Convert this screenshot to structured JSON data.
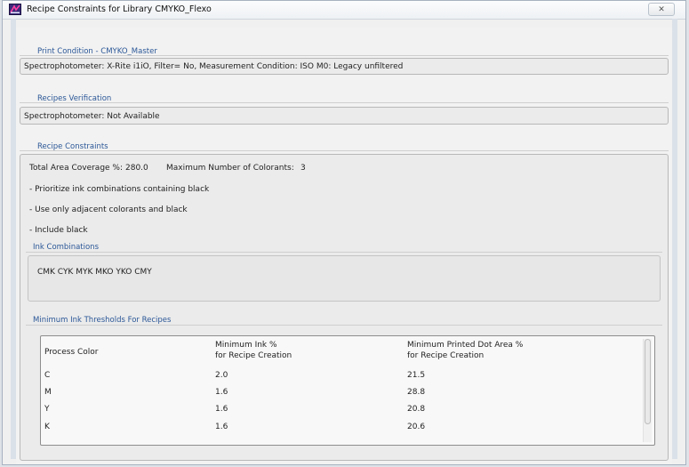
{
  "window": {
    "title": "Recipe Constraints for Library CMYKO_Flexo",
    "close_symbol": "✕"
  },
  "print_condition": {
    "label": "Print Condition - CMYKO_Master",
    "text": "Spectrophotometer: X-Rite i1iO,   Filter= No,   Measurement Condition: ISO M0: Legacy unfiltered"
  },
  "recipes_verification": {
    "label": "Recipes Verification",
    "text": "Spectrophotometer: Not Available"
  },
  "recipe_constraints": {
    "label": "Recipe Constraints",
    "tac_label": "Total Area Coverage %:",
    "tac_value": "280.0",
    "max_colorants_label": "Maximum Number of Colorants:",
    "max_colorants_value": "3",
    "rules": [
      "- Prioritize ink combinations containing black",
      "- Use only adjacent colorants and black",
      "- Include black"
    ]
  },
  "ink_combinations": {
    "label": "Ink Combinations",
    "value": "CMK CYK MYK MKO YKO CMY"
  },
  "thresholds": {
    "label": "Minimum Ink Thresholds For Recipes",
    "headers": {
      "process_color": "Process Color",
      "min_ink_1": "Minimum Ink %",
      "min_ink_2": "for Recipe Creation",
      "min_dot_1": "Minimum Printed Dot Area %",
      "min_dot_2": "for Recipe Creation"
    },
    "rows": [
      {
        "color": "C",
        "min_ink": "2.0",
        "min_dot": "21.5"
      },
      {
        "color": "M",
        "min_ink": "1.6",
        "min_dot": "28.8"
      },
      {
        "color": "Y",
        "min_ink": "1.6",
        "min_dot": "20.8"
      },
      {
        "color": "K",
        "min_ink": "1.6",
        "min_dot": "20.6"
      }
    ]
  }
}
